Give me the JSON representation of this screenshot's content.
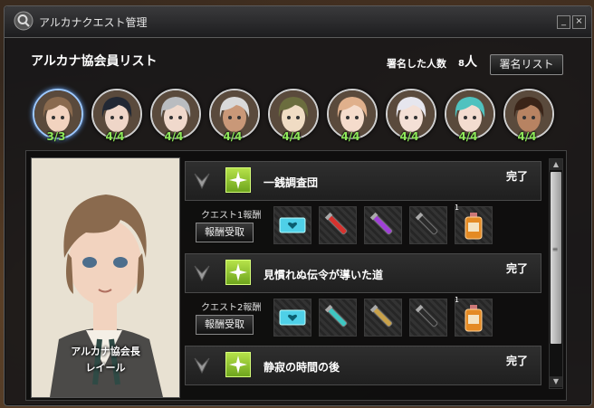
{
  "window": {
    "title": "アルカナクエスト管理",
    "minimize": "_",
    "close": "×"
  },
  "header": {
    "title": "アルカナ協会員リスト",
    "signed_label": "署名した人数",
    "signed_count": "8",
    "signed_unit": "人",
    "sign_list_button": "署名リスト"
  },
  "members": [
    {
      "ratio": "3/3",
      "hair": "#8a6a4e",
      "skin": "#f2d3bf",
      "selected": true
    },
    {
      "ratio": "4/4",
      "hair": "#222834",
      "skin": "#efd6c8",
      "selected": false
    },
    {
      "ratio": "4/4",
      "hair": "#b9bcc0",
      "skin": "#f0d9cc",
      "selected": false
    },
    {
      "ratio": "4/4",
      "hair": "#d9d9d9",
      "skin": "#c99878",
      "selected": false
    },
    {
      "ratio": "4/4",
      "hair": "#6b6d3e",
      "skin": "#f0dcc4",
      "selected": false
    },
    {
      "ratio": "4/4",
      "hair": "#e0b08c",
      "skin": "#f5dccc",
      "selected": false
    },
    {
      "ratio": "4/4",
      "hair": "#e6e6ee",
      "skin": "#f4e0d6",
      "selected": false
    },
    {
      "ratio": "4/4",
      "hair": "#4fc2bf",
      "skin": "#f3dcd0",
      "selected": false
    },
    {
      "ratio": "4/4",
      "hair": "#3a2418",
      "skin": "#b78362",
      "selected": false
    }
  ],
  "leader": {
    "role": "アルカナ協会長",
    "name": "レイール"
  },
  "quests": [
    {
      "name": "一銭調査団",
      "status": "完了",
      "reward_label": "クエスト1報酬",
      "claim": "報酬受取",
      "rewards": [
        {
          "icon": "ticket-icon",
          "color": "#4fd0e8",
          "count": ""
        },
        {
          "icon": "red-potion-icon",
          "color": "#d8322e",
          "count": ""
        },
        {
          "icon": "purple-potion-icon",
          "color": "#a040d8",
          "count": ""
        },
        {
          "icon": "black-potion-icon",
          "color": "#2a2a2a",
          "count": ""
        },
        {
          "icon": "bottle-icon",
          "color": "#e48a24",
          "count": "1"
        }
      ]
    },
    {
      "name": "見慣れぬ伝令が導いた道",
      "status": "完了",
      "reward_label": "クエスト2報酬",
      "claim": "報酬受取",
      "rewards": [
        {
          "icon": "ticket-icon",
          "color": "#4fd0e8",
          "count": ""
        },
        {
          "icon": "cyan-potion-icon",
          "color": "#3ec7c2",
          "count": ""
        },
        {
          "icon": "gold-potion-icon",
          "color": "#c9a24a",
          "count": ""
        },
        {
          "icon": "black-potion-icon",
          "color": "#2a2a2a",
          "count": ""
        },
        {
          "icon": "bottle-icon",
          "color": "#e48a24",
          "count": "1"
        }
      ]
    },
    {
      "name": "静寂の時間の後",
      "status": "完了"
    }
  ]
}
